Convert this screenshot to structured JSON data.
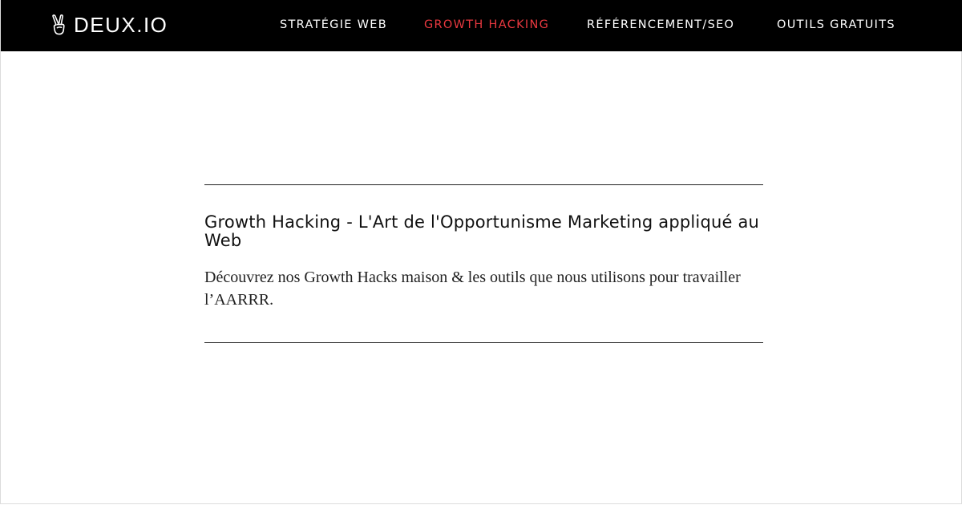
{
  "header": {
    "brand": {
      "icon": "victory-hand-icon",
      "name": "DEUX.IO"
    },
    "nav": [
      {
        "label": "STRATÉGIE WEB",
        "active": false
      },
      {
        "label": "GROWTH HACKING",
        "active": true
      },
      {
        "label": "RÉFÉRENCEMENT/SEO",
        "active": false
      },
      {
        "label": "OUTILS GRATUITS",
        "active": false
      }
    ]
  },
  "main": {
    "title": "Growth Hacking - L'Art de l'Opportunisme Marketing appliqué au Web",
    "subtitle": "Découvrez nos Growth Hacks maison & les outils que nous utilisons pour travailler l’AARRR."
  },
  "colors": {
    "navbar_background": "#000000",
    "nav_text": "#ffffff",
    "nav_active": "#e8383f",
    "page_background": "#ffffff",
    "body_text": "#111111"
  }
}
